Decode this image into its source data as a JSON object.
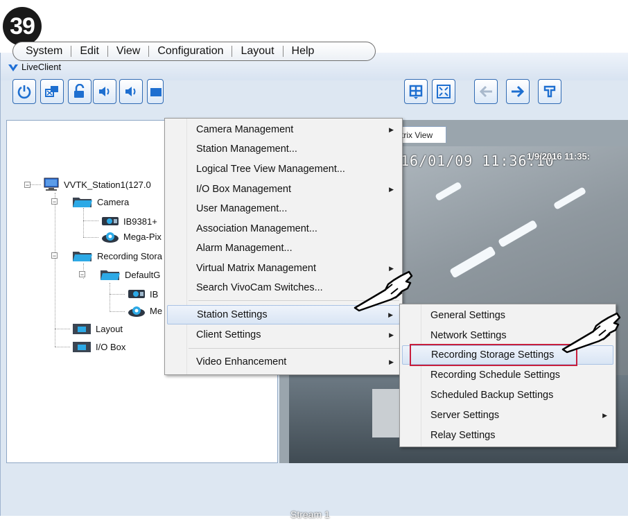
{
  "step": {
    "number": "39"
  },
  "window": {
    "title": "LiveClient"
  },
  "menubar": {
    "items": [
      {
        "label": "System"
      },
      {
        "label": "Edit"
      },
      {
        "label": "View"
      },
      {
        "label": "Configuration"
      },
      {
        "label": "Layout"
      },
      {
        "label": "Help"
      }
    ]
  },
  "toolbar": {
    "buttons": [
      {
        "icon": "power-icon"
      },
      {
        "icon": "network-station-icon"
      },
      {
        "icon": "unlock-icon"
      },
      {
        "icon": "speaker-icon"
      },
      {
        "icon": "folder-icon"
      },
      {
        "icon": "layout-grid-icon"
      },
      {
        "icon": "fullscreen-icon"
      },
      {
        "icon": "arrow-left-icon"
      },
      {
        "icon": "arrow-right-icon"
      },
      {
        "icon": "patrol-icon"
      }
    ]
  },
  "tree": {
    "station": "VVTK_Station1(127.0",
    "camera_folder": "Camera",
    "camera1": "IB9381+",
    "camera2": "Mega-Pix",
    "recording_folder": "Recording Stora",
    "default_group": "DefaultG",
    "rec_cam1": "IB",
    "rec_cam2": "Me",
    "layout": "Layout",
    "io_box": "I/O Box"
  },
  "tab": {
    "label": "trix View"
  },
  "video": {
    "osd_timestamp": "16/01/09 11:36:10",
    "osd_overlay": "1/9/2016 11:35:",
    "stream_label": "Stream 1"
  },
  "configuration_menu": {
    "items": [
      {
        "label": "Camera Management",
        "submenu": true
      },
      {
        "label": "Station Management...",
        "submenu": false
      },
      {
        "label": "Logical Tree View Management...",
        "submenu": false
      },
      {
        "label": "I/O Box Management",
        "submenu": true
      },
      {
        "label": "User Management...",
        "submenu": false
      },
      {
        "label": "Association Management...",
        "submenu": false
      },
      {
        "label": "Alarm Management...",
        "submenu": false
      },
      {
        "label": "Virtual Matrix Management",
        "submenu": true
      },
      {
        "label": "Search VivoCam Switches...",
        "submenu": false
      },
      {
        "label": "Station Settings",
        "submenu": true,
        "highlighted": true
      },
      {
        "label": "Client Settings",
        "submenu": true
      },
      {
        "label": "Video Enhancement",
        "submenu": true
      }
    ]
  },
  "station_settings_submenu": {
    "items": [
      {
        "label": "General Settings",
        "submenu": false
      },
      {
        "label": "Network Settings",
        "submenu": false
      },
      {
        "label": "Recording Storage Settings",
        "submenu": false,
        "highlighted": true
      },
      {
        "label": "Recording Schedule Settings",
        "submenu": false
      },
      {
        "label": "Scheduled Backup Settings",
        "submenu": false
      },
      {
        "label": "Server Settings",
        "submenu": true
      },
      {
        "label": "Relay Settings",
        "submenu": false
      }
    ]
  },
  "colors": {
    "highlight_box": "#c81e3c",
    "accent": "#1e6fd0",
    "menu_bg": "#f2f2f2"
  }
}
